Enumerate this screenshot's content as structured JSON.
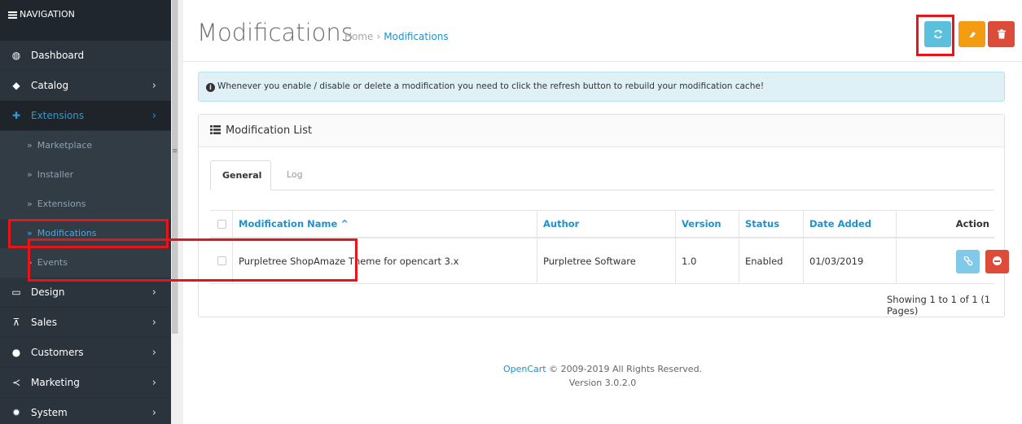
{
  "sidebar": {
    "header": "NAVIGATION",
    "items": [
      {
        "label": "Dashboard",
        "icon": "dashboard-icon",
        "has_children": false
      },
      {
        "label": "Catalog",
        "icon": "tag-icon",
        "has_children": true
      },
      {
        "label": "Extensions",
        "icon": "puzzle-icon",
        "has_children": true,
        "active": true
      },
      {
        "label": "Design",
        "icon": "monitor-icon",
        "has_children": true
      },
      {
        "label": "Sales",
        "icon": "cart-icon",
        "has_children": true
      },
      {
        "label": "Customers",
        "icon": "user-icon",
        "has_children": true
      },
      {
        "label": "Marketing",
        "icon": "share-icon",
        "has_children": true
      },
      {
        "label": "System",
        "icon": "cog-icon",
        "has_children": true
      }
    ],
    "extensions_submenu": [
      {
        "label": "Marketplace"
      },
      {
        "label": "Installer"
      },
      {
        "label": "Extensions"
      },
      {
        "label": "Modifications",
        "current": true
      },
      {
        "label": "Events"
      }
    ]
  },
  "header": {
    "title": "Modifications",
    "breadcrumb": [
      "Home",
      "Modifications"
    ],
    "buttons": [
      {
        "name": "refresh",
        "icon": "refresh-icon",
        "color": "#5bc0de"
      },
      {
        "name": "clear",
        "icon": "eraser-icon",
        "color": "#f39c12"
      },
      {
        "name": "delete",
        "icon": "trash-icon",
        "color": "#dd4b39"
      }
    ]
  },
  "alert": {
    "text": "Whenever you enable / disable or delete a modification you need to click the refresh button to rebuild your modification cache!"
  },
  "panel": {
    "title": "Modification List",
    "tabs": [
      "General",
      "Log"
    ],
    "active_tab": "General",
    "table": {
      "columns": [
        "Modification Name ^",
        "Author",
        "Version",
        "Status",
        "Date Added",
        "Action"
      ],
      "rows": [
        {
          "name": "Purpletree ShopAmaze Theme for opencart 3.x",
          "author": "Purpletree Software",
          "version": "1.0",
          "status": "Enabled",
          "date_added": "01/03/2019"
        }
      ]
    },
    "pagination": "Showing 1 to 1 of 1 (1 Pages)"
  },
  "footer": {
    "brand": "OpenCart",
    "copyright": "© 2009-2019 All Rights Reserved.",
    "version": "Version 3.0.2.0"
  },
  "colors": {
    "sidebar_bg": "#2b343c",
    "accent": "#1e91cf",
    "highlight": "#e8141a"
  }
}
